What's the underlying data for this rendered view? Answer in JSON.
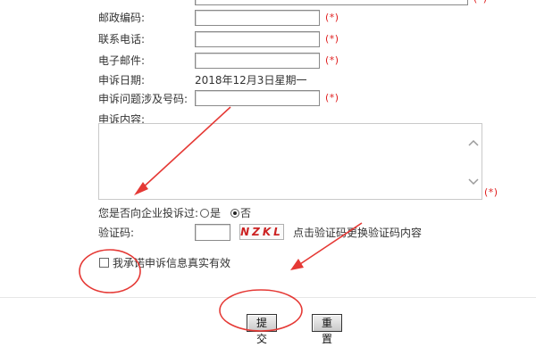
{
  "form": {
    "postcode_label": "邮政编码:",
    "phone_label": "联系电话:",
    "email_label": "电子邮件:",
    "date_label": "申诉日期:",
    "date_value": "2018年12月3日星期一",
    "issue_label": "申诉问题涉及号码:",
    "content_label": "申诉内容:",
    "required_mark": "(*)",
    "complained_label": "您是否向企业投诉过:",
    "radio_yes": "是",
    "radio_no": "否",
    "radio_selected": "否",
    "captcha_label": "验证码:",
    "captcha_value": "",
    "captcha_image_text": "NZKL",
    "captcha_hint": "点击验证码更换验证码内容",
    "pledge_label": "我承诺申诉信息真实有效"
  },
  "buttons": {
    "submit": "提 交",
    "reset": "重 置"
  },
  "colors": {
    "required": "#e02020",
    "annotation": "#e53935"
  }
}
